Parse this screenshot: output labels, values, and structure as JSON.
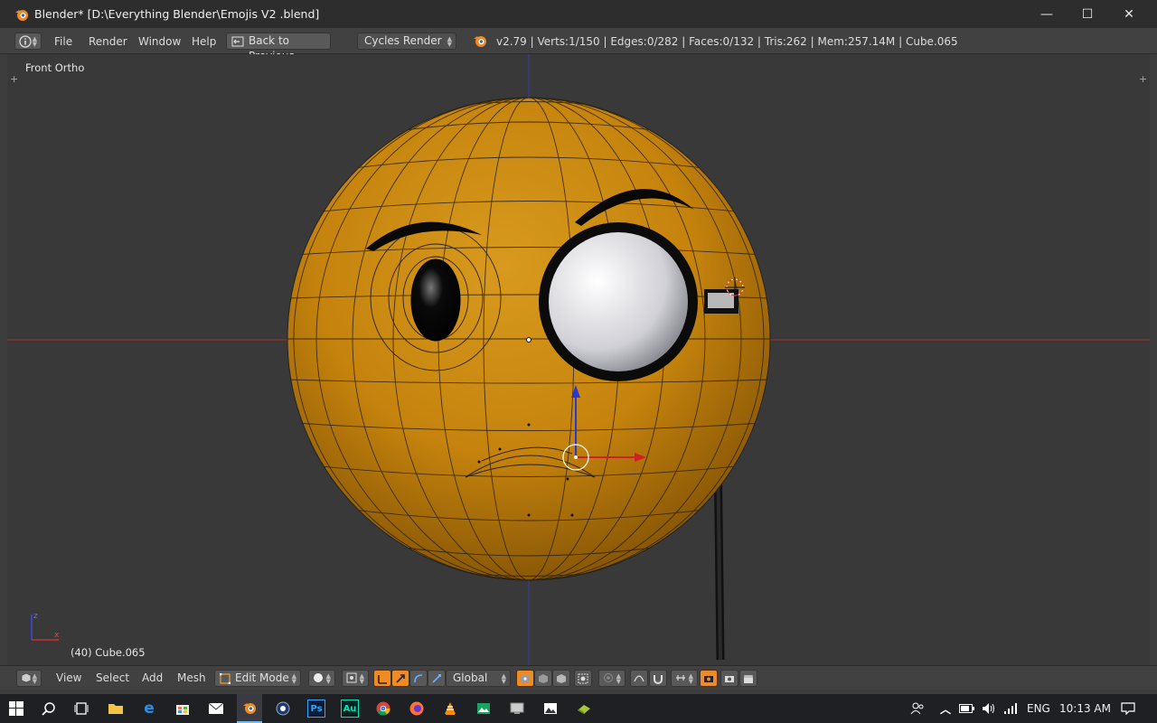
{
  "window": {
    "title": "Blender* [D:\\Everything Blender\\Emojis V2 .blend]",
    "controls": {
      "minimize": "—",
      "maximize": "☐",
      "close": "✕"
    }
  },
  "infobar": {
    "menus": [
      "File",
      "Render",
      "Window",
      "Help"
    ],
    "back_label": "Back to Previous",
    "engine": "Cycles Render",
    "stats": "v2.79 | Verts:1/150 | Edges:0/282 | Faces:0/132 | Tris:262 | Mem:257.14M | Cube.065"
  },
  "viewport": {
    "view_name": "Front Ortho",
    "object_label": "(40) Cube.065",
    "colors": {
      "background": "#393939",
      "face": "#c8860f",
      "x_axis": "#c03030",
      "z_axis": "#3040c8"
    }
  },
  "viewheader": {
    "menus": [
      "View",
      "Select",
      "Add",
      "Mesh"
    ],
    "mode": "Edit Mode",
    "orientation": "Global"
  },
  "taskbar": {
    "language": "ENG",
    "time": "10:13 AM",
    "apps": [
      "file-explorer-icon",
      "edge-icon",
      "store-icon",
      "mail-icon",
      "blender-icon",
      "cinema4d-icon",
      "photoshop-icon",
      "audition-icon",
      "chrome-icon",
      "firefox-icon",
      "vlc-icon",
      "photos-icon",
      "remote-icon",
      "image-viewer-icon",
      "android-icon"
    ]
  }
}
